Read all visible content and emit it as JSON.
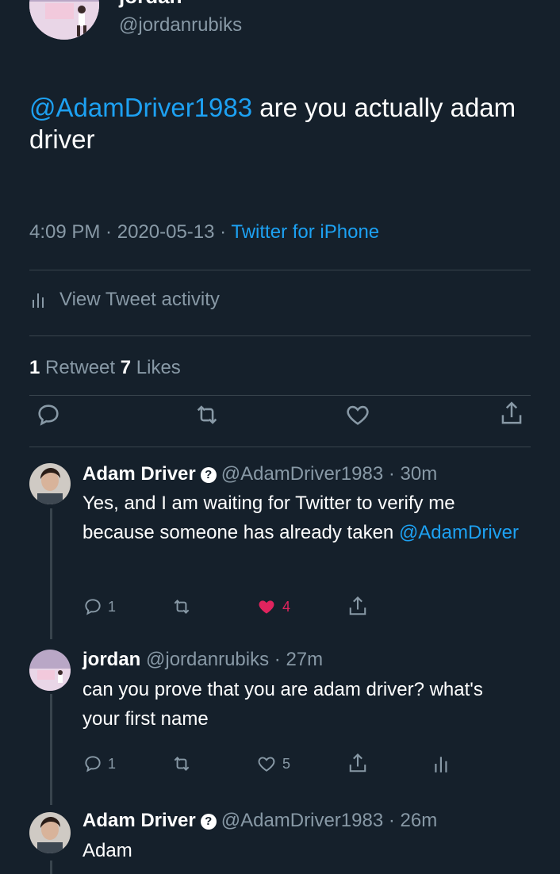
{
  "header": {
    "name": "jordan",
    "handle": "@jordanrubiks"
  },
  "tweet": {
    "mention": "@AdamDriver1983",
    "text": " are you actually adam driver",
    "time": "4:09 PM",
    "sep1": " · ",
    "date": "2020-05-13",
    "sep2": " · ",
    "source": "Twitter for iPhone"
  },
  "activity": {
    "label": "View Tweet activity"
  },
  "counts": {
    "retweets": "1",
    "retweets_label": " Retweet",
    "likes": "7",
    "likes_label": " Likes"
  },
  "replies": [
    {
      "name": "Adam Driver",
      "handle": "@AdamDriver1983",
      "time": " · 30m",
      "text": "Yes, and I am waiting for Twitter to verify me because someone has already taken",
      "mention": "@AdamDriver",
      "reply_count": "1",
      "like_count": "4"
    },
    {
      "name": "jordan",
      "handle": "@jordanrubiks",
      "time": " · 27m",
      "text": "can you prove that you are adam driver? what's your first name",
      "reply_count": "1",
      "like_count": "5"
    },
    {
      "name": "Adam Driver",
      "handle": "@AdamDriver1983",
      "time": " · 26m",
      "text": "Adam"
    }
  ],
  "colors": {
    "background": "#15202b",
    "accent": "#1da1f2",
    "muted": "#8899a6",
    "like": "#e0245e"
  }
}
